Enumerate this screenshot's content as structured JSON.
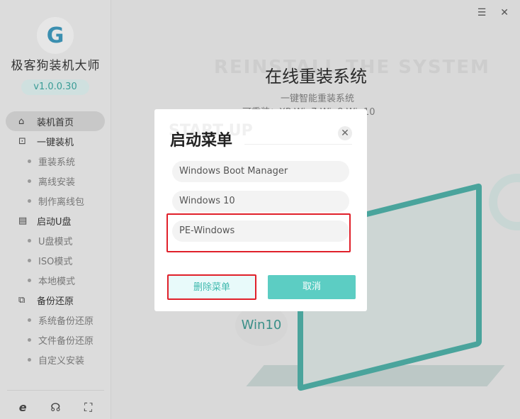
{
  "app": {
    "name": "极客狗装机大师",
    "version": "v1.0.0.30",
    "logo_letter": "G"
  },
  "window": {
    "menu_icon": "☰",
    "close_icon": "✕"
  },
  "sidebar": {
    "items": [
      {
        "label": "装机首页",
        "icon": "⌂",
        "active": true
      },
      {
        "label": "一键装机",
        "icon": "⊡",
        "children": [
          "重装系统",
          "离线安装",
          "制作离线包"
        ]
      },
      {
        "label": "启动U盘",
        "icon": "▤",
        "children": [
          "U盘模式",
          "ISO模式",
          "本地模式"
        ]
      },
      {
        "label": "备份还原",
        "icon": "⧉",
        "children": [
          "系统备份还原",
          "文件备份还原",
          "自定义安装"
        ]
      }
    ],
    "footer_icons": [
      "ie-icon",
      "support-headset-icon",
      "fullscreen-icon"
    ]
  },
  "main": {
    "bg_title": "REINSTALL THE SYSTEM",
    "title": "在线重装系统",
    "subtitle": "一键智能重装系统",
    "os_line": "可重装：XP   Win7   Win8   Win10",
    "badge": "Win10"
  },
  "dialog": {
    "bg_text": "START UP",
    "title": "启动菜单",
    "options": [
      "Windows Boot Manager",
      "Windows 10",
      "PE-Windows"
    ],
    "selected": "PE-Windows",
    "delete_label": "删除菜单",
    "cancel_label": "取消",
    "accent": "#5ccdc3"
  }
}
